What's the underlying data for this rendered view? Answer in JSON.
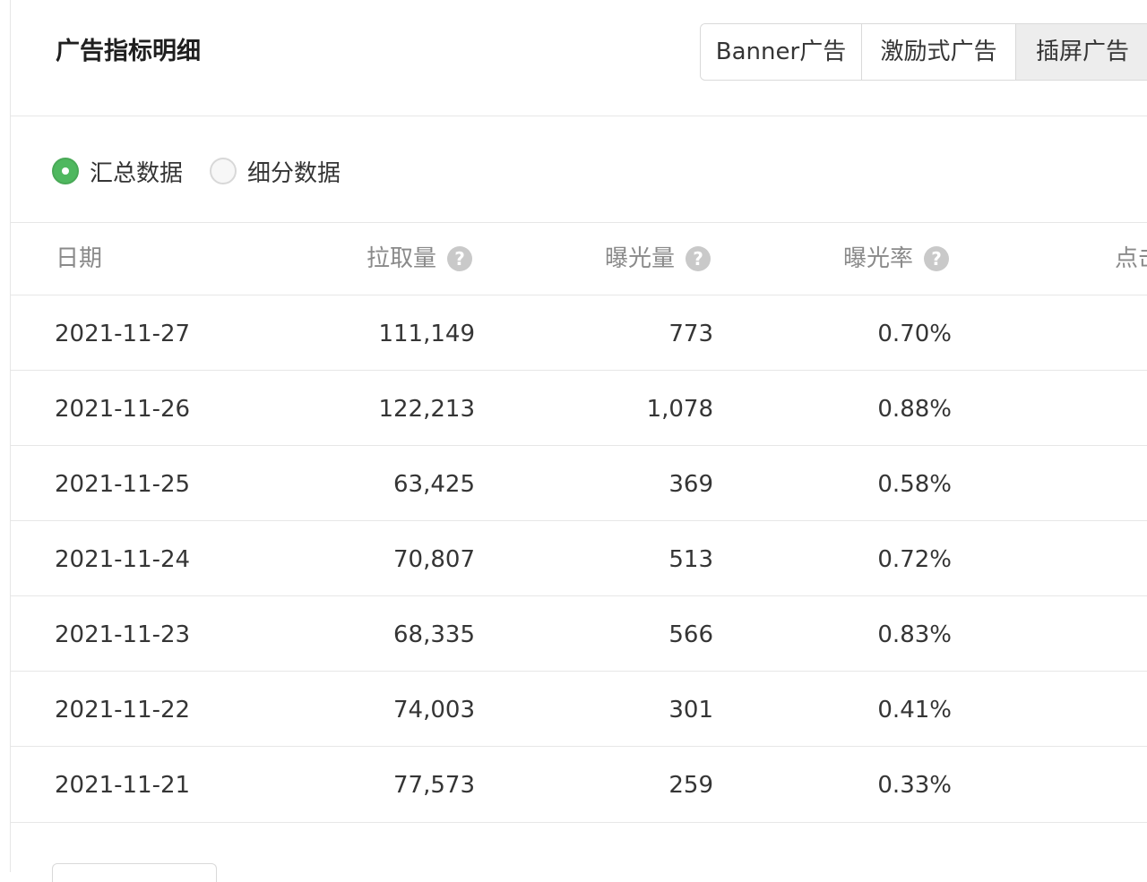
{
  "header": {
    "title": "广告指标明细",
    "tabs": [
      {
        "label": "Banner广告",
        "active": false
      },
      {
        "label": "激励式广告",
        "active": false
      },
      {
        "label": "插屏广告",
        "active": true
      }
    ]
  },
  "filter": {
    "options": [
      {
        "label": "汇总数据",
        "checked": true
      },
      {
        "label": "细分数据",
        "checked": false
      }
    ]
  },
  "table": {
    "columns": [
      {
        "label": "日期",
        "help": false
      },
      {
        "label": "拉取量",
        "help": true
      },
      {
        "label": "曝光量",
        "help": true
      },
      {
        "label": "曝光率",
        "help": true
      },
      {
        "label": "点击",
        "help": false
      }
    ],
    "help_glyph": "?",
    "rows": [
      {
        "date": "2021-11-27",
        "pull": "111,149",
        "exposure": "773",
        "rate": "0.70%"
      },
      {
        "date": "2021-11-26",
        "pull": "122,213",
        "exposure": "1,078",
        "rate": "0.88%"
      },
      {
        "date": "2021-11-25",
        "pull": "63,425",
        "exposure": "369",
        "rate": "0.58%"
      },
      {
        "date": "2021-11-24",
        "pull": "70,807",
        "exposure": "513",
        "rate": "0.72%"
      },
      {
        "date": "2021-11-23",
        "pull": "68,335",
        "exposure": "566",
        "rate": "0.83%"
      },
      {
        "date": "2021-11-22",
        "pull": "74,003",
        "exposure": "301",
        "rate": "0.41%"
      },
      {
        "date": "2021-11-21",
        "pull": "77,573",
        "exposure": "259",
        "rate": "0.33%"
      }
    ]
  },
  "colors": {
    "accent_green": "#4fb85f",
    "active_tab_bg": "#ededed",
    "border": "#e7e7e7",
    "header_text": "#8a8a8a"
  }
}
